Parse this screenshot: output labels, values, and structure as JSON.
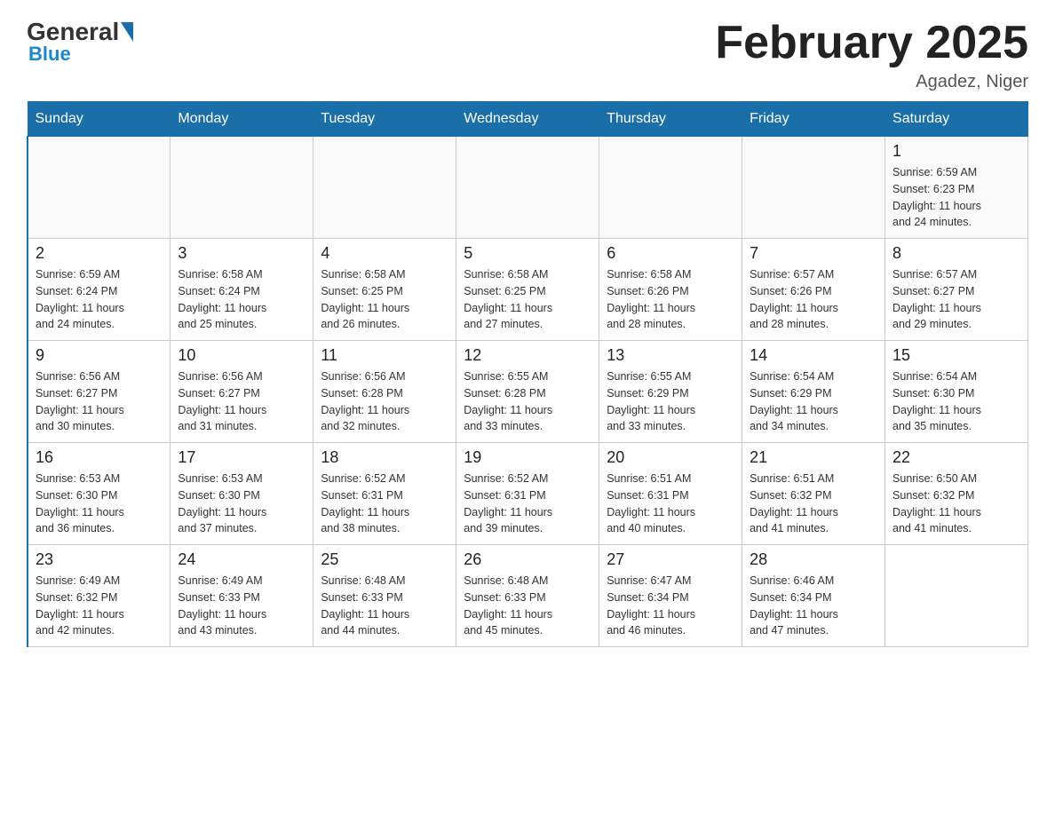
{
  "header": {
    "logo": {
      "general": "General",
      "blue": "Blue"
    },
    "title": "February 2025",
    "location": "Agadez, Niger"
  },
  "weekdays": [
    "Sunday",
    "Monday",
    "Tuesday",
    "Wednesday",
    "Thursday",
    "Friday",
    "Saturday"
  ],
  "weeks": [
    [
      {
        "day": "",
        "info": ""
      },
      {
        "day": "",
        "info": ""
      },
      {
        "day": "",
        "info": ""
      },
      {
        "day": "",
        "info": ""
      },
      {
        "day": "",
        "info": ""
      },
      {
        "day": "",
        "info": ""
      },
      {
        "day": "1",
        "info": "Sunrise: 6:59 AM\nSunset: 6:23 PM\nDaylight: 11 hours\nand 24 minutes."
      }
    ],
    [
      {
        "day": "2",
        "info": "Sunrise: 6:59 AM\nSunset: 6:24 PM\nDaylight: 11 hours\nand 24 minutes."
      },
      {
        "day": "3",
        "info": "Sunrise: 6:58 AM\nSunset: 6:24 PM\nDaylight: 11 hours\nand 25 minutes."
      },
      {
        "day": "4",
        "info": "Sunrise: 6:58 AM\nSunset: 6:25 PM\nDaylight: 11 hours\nand 26 minutes."
      },
      {
        "day": "5",
        "info": "Sunrise: 6:58 AM\nSunset: 6:25 PM\nDaylight: 11 hours\nand 27 minutes."
      },
      {
        "day": "6",
        "info": "Sunrise: 6:58 AM\nSunset: 6:26 PM\nDaylight: 11 hours\nand 28 minutes."
      },
      {
        "day": "7",
        "info": "Sunrise: 6:57 AM\nSunset: 6:26 PM\nDaylight: 11 hours\nand 28 minutes."
      },
      {
        "day": "8",
        "info": "Sunrise: 6:57 AM\nSunset: 6:27 PM\nDaylight: 11 hours\nand 29 minutes."
      }
    ],
    [
      {
        "day": "9",
        "info": "Sunrise: 6:56 AM\nSunset: 6:27 PM\nDaylight: 11 hours\nand 30 minutes."
      },
      {
        "day": "10",
        "info": "Sunrise: 6:56 AM\nSunset: 6:27 PM\nDaylight: 11 hours\nand 31 minutes."
      },
      {
        "day": "11",
        "info": "Sunrise: 6:56 AM\nSunset: 6:28 PM\nDaylight: 11 hours\nand 32 minutes."
      },
      {
        "day": "12",
        "info": "Sunrise: 6:55 AM\nSunset: 6:28 PM\nDaylight: 11 hours\nand 33 minutes."
      },
      {
        "day": "13",
        "info": "Sunrise: 6:55 AM\nSunset: 6:29 PM\nDaylight: 11 hours\nand 33 minutes."
      },
      {
        "day": "14",
        "info": "Sunrise: 6:54 AM\nSunset: 6:29 PM\nDaylight: 11 hours\nand 34 minutes."
      },
      {
        "day": "15",
        "info": "Sunrise: 6:54 AM\nSunset: 6:30 PM\nDaylight: 11 hours\nand 35 minutes."
      }
    ],
    [
      {
        "day": "16",
        "info": "Sunrise: 6:53 AM\nSunset: 6:30 PM\nDaylight: 11 hours\nand 36 minutes."
      },
      {
        "day": "17",
        "info": "Sunrise: 6:53 AM\nSunset: 6:30 PM\nDaylight: 11 hours\nand 37 minutes."
      },
      {
        "day": "18",
        "info": "Sunrise: 6:52 AM\nSunset: 6:31 PM\nDaylight: 11 hours\nand 38 minutes."
      },
      {
        "day": "19",
        "info": "Sunrise: 6:52 AM\nSunset: 6:31 PM\nDaylight: 11 hours\nand 39 minutes."
      },
      {
        "day": "20",
        "info": "Sunrise: 6:51 AM\nSunset: 6:31 PM\nDaylight: 11 hours\nand 40 minutes."
      },
      {
        "day": "21",
        "info": "Sunrise: 6:51 AM\nSunset: 6:32 PM\nDaylight: 11 hours\nand 41 minutes."
      },
      {
        "day": "22",
        "info": "Sunrise: 6:50 AM\nSunset: 6:32 PM\nDaylight: 11 hours\nand 41 minutes."
      }
    ],
    [
      {
        "day": "23",
        "info": "Sunrise: 6:49 AM\nSunset: 6:32 PM\nDaylight: 11 hours\nand 42 minutes."
      },
      {
        "day": "24",
        "info": "Sunrise: 6:49 AM\nSunset: 6:33 PM\nDaylight: 11 hours\nand 43 minutes."
      },
      {
        "day": "25",
        "info": "Sunrise: 6:48 AM\nSunset: 6:33 PM\nDaylight: 11 hours\nand 44 minutes."
      },
      {
        "day": "26",
        "info": "Sunrise: 6:48 AM\nSunset: 6:33 PM\nDaylight: 11 hours\nand 45 minutes."
      },
      {
        "day": "27",
        "info": "Sunrise: 6:47 AM\nSunset: 6:34 PM\nDaylight: 11 hours\nand 46 minutes."
      },
      {
        "day": "28",
        "info": "Sunrise: 6:46 AM\nSunset: 6:34 PM\nDaylight: 11 hours\nand 47 minutes."
      },
      {
        "day": "",
        "info": ""
      }
    ]
  ]
}
